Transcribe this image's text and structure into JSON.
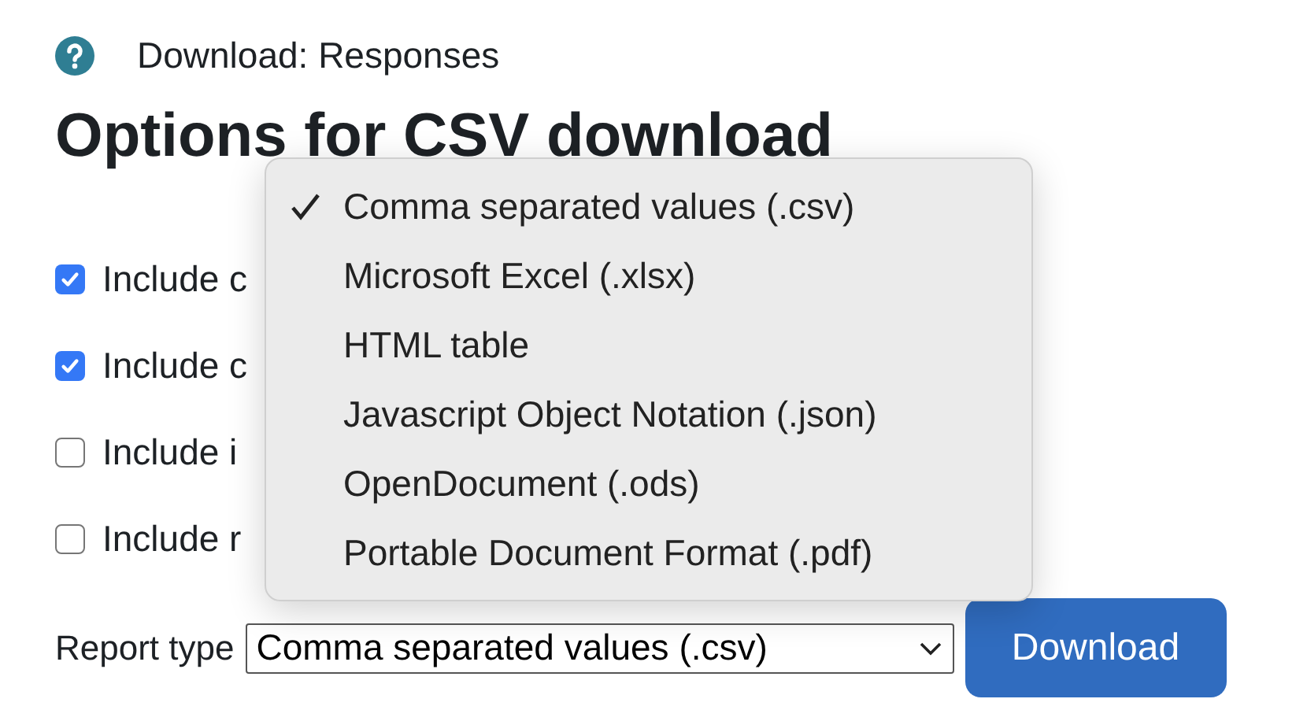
{
  "help_title": "Download: Responses",
  "heading": "Options for CSV download",
  "options": [
    {
      "label": "Include c",
      "checked": true
    },
    {
      "label": "Include c",
      "checked": true
    },
    {
      "label": "Include i",
      "checked": false
    },
    {
      "label": "Include r",
      "checked": false
    }
  ],
  "report_type": {
    "label": "Report type",
    "value": "Comma separated values (.csv)"
  },
  "download_button": "Download",
  "dropdown_menu": {
    "items": [
      {
        "label": "Comma separated values (.csv)",
        "selected": true
      },
      {
        "label": "Microsoft Excel (.xlsx)",
        "selected": false
      },
      {
        "label": "HTML table",
        "selected": false
      },
      {
        "label": "Javascript Object Notation (.json)",
        "selected": false
      },
      {
        "label": "OpenDocument (.ods)",
        "selected": false
      },
      {
        "label": "Portable Document Format (.pdf)",
        "selected": false
      }
    ]
  }
}
